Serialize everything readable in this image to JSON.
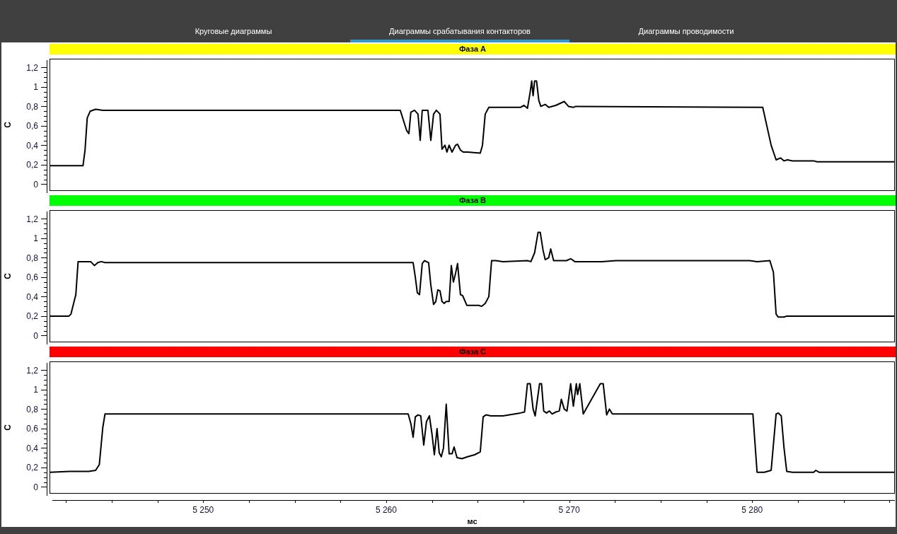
{
  "tabs": [
    {
      "label": "Круговые диаграммы",
      "selected": false
    },
    {
      "label": "Диаграммы срабатывания контакторов",
      "selected": true
    },
    {
      "label": "Диаграммы проводимости",
      "selected": false
    }
  ],
  "phases": [
    {
      "color": "#ffff00",
      "chart_data": {
        "type": "line",
        "title": "Фаза A",
        "ylabel": "С",
        "xlim": [
          5241.6,
          5287.8
        ],
        "ylim": [
          -0.07,
          1.29
        ],
        "yticks": [
          {
            "value": 0,
            "label": "0"
          },
          {
            "value": 0.2,
            "label": "0,2"
          },
          {
            "value": 0.4,
            "label": "0,4"
          },
          {
            "value": 0.6,
            "label": "0,6"
          },
          {
            "value": 0.8,
            "label": "0,8"
          },
          {
            "value": 1,
            "label": "1"
          },
          {
            "value": 1.2,
            "label": "1,2"
          }
        ],
        "x": [
          5241.61,
          5243.43,
          5243.54,
          5243.66,
          5243.82,
          5244.12,
          5244.51,
          5260.77,
          5261.12,
          5261.24,
          5261.35,
          5261.55,
          5261.74,
          5261.86,
          5261.97,
          5262.28,
          5262.44,
          5262.59,
          5262.74,
          5262.94,
          5263.05,
          5263.21,
          5263.32,
          5263.44,
          5263.6,
          5263.79,
          5263.9,
          5264.06,
          5264.21,
          5264.45,
          5265.14,
          5265.26,
          5265.41,
          5265.61,
          5267.33,
          5267.53,
          5267.72,
          5267.87,
          5267.95,
          5268.03,
          5268.11,
          5268.22,
          5268.34,
          5268.45,
          5268.69,
          5268.88,
          5269.27,
          5269.73,
          5269.96,
          5270.23,
          5270.35,
          5280.58,
          5281.04,
          5281.31,
          5281.55,
          5281.74,
          5281.93,
          5282.2,
          5283.36,
          5283.55,
          5287.8
        ],
        "values": [
          0.19,
          0.19,
          0.35,
          0.68,
          0.75,
          0.77,
          0.76,
          0.76,
          0.55,
          0.52,
          0.74,
          0.76,
          0.72,
          0.45,
          0.76,
          0.76,
          0.45,
          0.72,
          0.76,
          0.72,
          0.36,
          0.4,
          0.33,
          0.4,
          0.33,
          0.4,
          0.41,
          0.35,
          0.33,
          0.33,
          0.32,
          0.4,
          0.72,
          0.79,
          0.79,
          0.81,
          0.78,
          0.95,
          1.06,
          0.91,
          1.06,
          1.06,
          0.86,
          0.8,
          0.82,
          0.79,
          0.81,
          0.85,
          0.8,
          0.79,
          0.8,
          0.79,
          0.4,
          0.25,
          0.27,
          0.24,
          0.25,
          0.24,
          0.24,
          0.23,
          0.23
        ]
      }
    },
    {
      "color": "#00ff00",
      "chart_data": {
        "type": "line",
        "title": "Фаза B",
        "ylabel": "С",
        "xlim": [
          5241.6,
          5287.8
        ],
        "ylim": [
          -0.07,
          1.29
        ],
        "yticks": [
          {
            "value": 0,
            "label": "0"
          },
          {
            "value": 0.2,
            "label": "0,2"
          },
          {
            "value": 0.4,
            "label": "0,4"
          },
          {
            "value": 0.6,
            "label": "0,6"
          },
          {
            "value": 0.8,
            "label": "0,8"
          },
          {
            "value": 1,
            "label": "1"
          },
          {
            "value": 1.2,
            "label": "1,2"
          }
        ],
        "x": [
          5241.61,
          5242.66,
          5242.77,
          5243.04,
          5243.16,
          5243.85,
          5244.05,
          5244.24,
          5244.43,
          5244.63,
          5261.47,
          5261.59,
          5261.7,
          5261.82,
          5261.97,
          5262.09,
          5262.32,
          5262.44,
          5262.59,
          5262.71,
          5262.82,
          5262.94,
          5263.05,
          5263.17,
          5263.28,
          5263.44,
          5263.56,
          5263.67,
          5263.79,
          5263.9,
          5264.06,
          5264.18,
          5264.41,
          5265.06,
          5265.22,
          5265.41,
          5265.61,
          5265.76,
          5265.99,
          5266.38,
          5267.72,
          5267.91,
          5268.11,
          5268.3,
          5268.42,
          5268.57,
          5268.69,
          5268.88,
          5268.99,
          5269.15,
          5269.85,
          5270.08,
          5270.31,
          5271.01,
          5271.78,
          5272.55,
          5279.88,
          5280.27,
          5280.97,
          5281.16,
          5281.31,
          5281.43,
          5281.74,
          5281.89,
          5287.8
        ],
        "values": [
          0.2,
          0.2,
          0.22,
          0.42,
          0.76,
          0.76,
          0.72,
          0.75,
          0.76,
          0.75,
          0.75,
          0.6,
          0.44,
          0.42,
          0.74,
          0.77,
          0.75,
          0.52,
          0.32,
          0.35,
          0.47,
          0.46,
          0.35,
          0.33,
          0.35,
          0.35,
          0.72,
          0.55,
          0.64,
          0.74,
          0.42,
          0.41,
          0.31,
          0.31,
          0.3,
          0.33,
          0.4,
          0.77,
          0.77,
          0.76,
          0.77,
          0.76,
          0.85,
          1.06,
          1.06,
          0.88,
          0.78,
          0.8,
          0.89,
          0.77,
          0.77,
          0.79,
          0.76,
          0.76,
          0.76,
          0.77,
          0.77,
          0.76,
          0.77,
          0.65,
          0.22,
          0.19,
          0.19,
          0.2,
          0.2
        ]
      }
    },
    {
      "color": "#ff0000",
      "chart_data": {
        "type": "line",
        "title": "Фаза C",
        "ylabel": "С",
        "xlabel": "мс",
        "xlim": [
          5241.6,
          5287.8
        ],
        "ylim": [
          -0.07,
          1.29
        ],
        "yticks": [
          {
            "value": 0,
            "label": "0"
          },
          {
            "value": 0.2,
            "label": "0,2"
          },
          {
            "value": 0.4,
            "label": "0,4"
          },
          {
            "value": 0.6,
            "label": "0,6"
          },
          {
            "value": 0.8,
            "label": "0,8"
          },
          {
            "value": 1,
            "label": "1"
          },
          {
            "value": 1.2,
            "label": "1,2"
          }
        ],
        "xticks": [
          {
            "value": 5250,
            "label": "5 250"
          },
          {
            "value": 5260,
            "label": "5 260"
          },
          {
            "value": 5270,
            "label": "5 270"
          },
          {
            "value": 5280,
            "label": "5 280"
          }
        ],
        "x": [
          5241.61,
          5242.69,
          5243.35,
          5243.74,
          5244.12,
          5244.32,
          5244.51,
          5244.63,
          5244.78,
          5261.2,
          5261.35,
          5261.47,
          5261.59,
          5261.74,
          5261.89,
          5262.05,
          5262.2,
          5262.36,
          5262.51,
          5262.63,
          5262.78,
          5262.9,
          5263.01,
          5263.13,
          5263.28,
          5263.44,
          5263.6,
          5263.71,
          5263.87,
          5264.14,
          5264.45,
          5264.83,
          5265.14,
          5265.3,
          5265.45,
          5265.72,
          5266.38,
          5267.33,
          5267.56,
          5267.72,
          5267.87,
          5268.03,
          5268.14,
          5268.38,
          5268.49,
          5268.61,
          5268.76,
          5268.92,
          5269.07,
          5269.27,
          5269.46,
          5269.57,
          5269.73,
          5269.88,
          5270.08,
          5270.23,
          5270.39,
          5270.46,
          5270.58,
          5270.77,
          5271.7,
          5271.86,
          5272.05,
          5272.2,
          5272.36,
          5273.71,
          5280.04,
          5280.27,
          5280.66,
          5281.04,
          5281.31,
          5281.43,
          5281.59,
          5281.74,
          5281.89,
          5282.2,
          5283.36,
          5283.48,
          5283.67,
          5287.8
        ],
        "values": [
          0.15,
          0.16,
          0.16,
          0.16,
          0.17,
          0.23,
          0.61,
          0.75,
          0.75,
          0.75,
          0.65,
          0.51,
          0.72,
          0.74,
          0.73,
          0.43,
          0.67,
          0.73,
          0.53,
          0.33,
          0.6,
          0.35,
          0.31,
          0.4,
          0.85,
          0.34,
          0.34,
          0.41,
          0.3,
          0.29,
          0.31,
          0.33,
          0.36,
          0.72,
          0.74,
          0.73,
          0.73,
          0.76,
          0.77,
          1.06,
          1.06,
          0.8,
          0.73,
          1.06,
          1.06,
          0.78,
          0.76,
          0.78,
          0.75,
          0.77,
          0.78,
          0.9,
          0.8,
          0.78,
          1.06,
          0.83,
          1.06,
          0.95,
          1.06,
          0.75,
          1.06,
          1.06,
          0.74,
          0.8,
          0.75,
          0.75,
          0.75,
          0.15,
          0.15,
          0.17,
          0.75,
          0.76,
          0.73,
          0.4,
          0.16,
          0.15,
          0.15,
          0.17,
          0.15,
          0.15
        ]
      }
    }
  ]
}
